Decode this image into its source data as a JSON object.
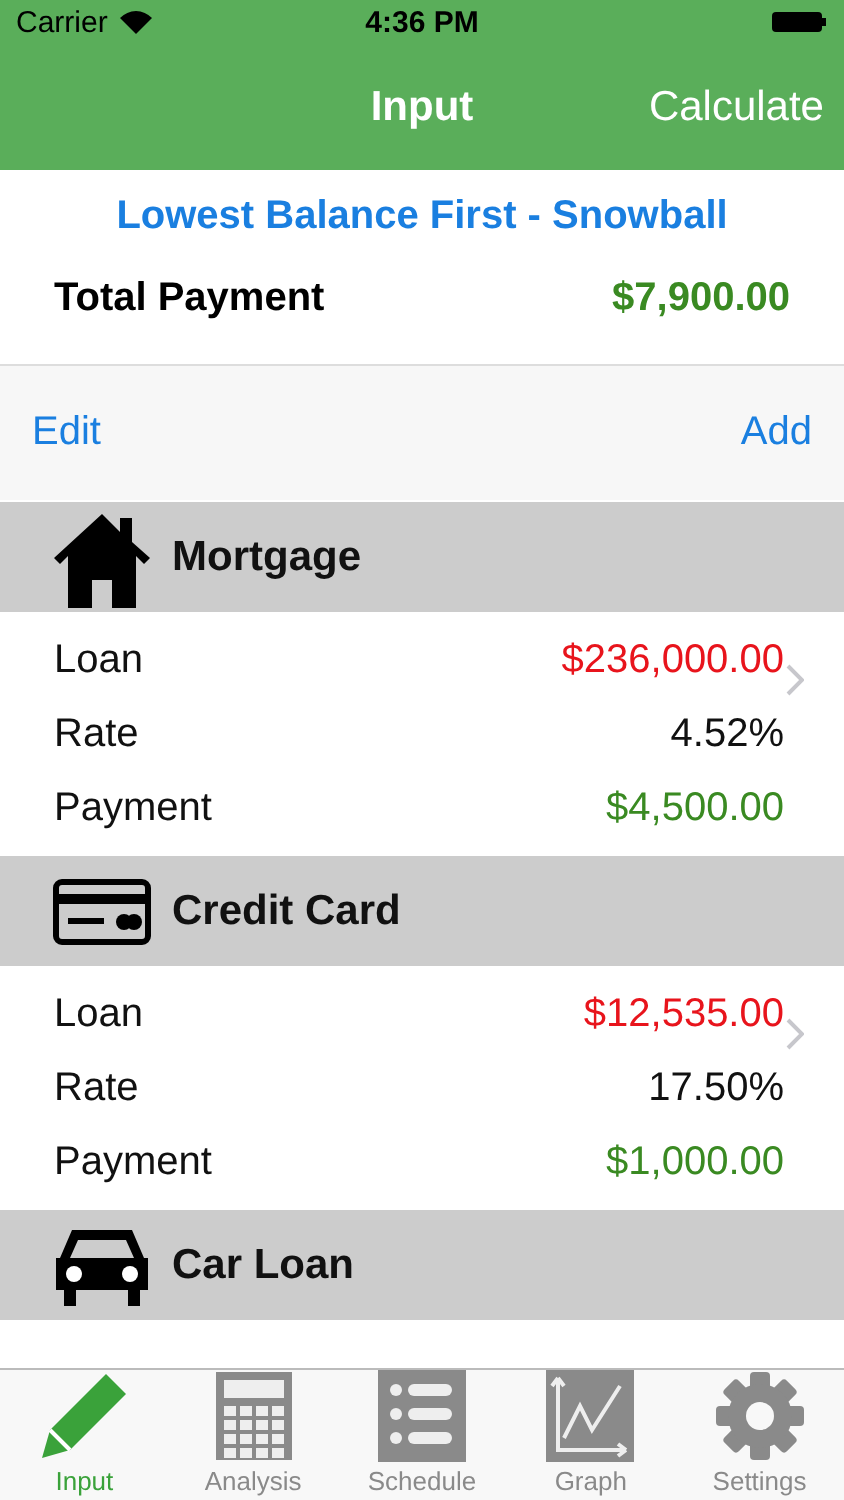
{
  "status_bar": {
    "carrier": "Carrier",
    "time": "4:36 PM"
  },
  "nav": {
    "title": "Input",
    "action": "Calculate"
  },
  "summary": {
    "strategy": "Lowest Balance First - Snowball",
    "total_label": "Total Payment",
    "total_value": "$7,900.00"
  },
  "toolbar": {
    "edit": "Edit",
    "add": "Add"
  },
  "debts": [
    {
      "name": "Mortgage",
      "kind": "house",
      "rows": [
        {
          "label": "Loan",
          "value": "$236,000.00",
          "kind": "loan"
        },
        {
          "label": "Rate",
          "value": "4.52%",
          "kind": "rate"
        },
        {
          "label": "Payment",
          "value": "$4,500.00",
          "kind": "payment"
        }
      ]
    },
    {
      "name": "Credit Card",
      "kind": "card",
      "rows": [
        {
          "label": "Loan",
          "value": "$12,535.00",
          "kind": "loan"
        },
        {
          "label": "Rate",
          "value": "17.50%",
          "kind": "rate"
        },
        {
          "label": "Payment",
          "value": "$1,000.00",
          "kind": "payment"
        }
      ]
    },
    {
      "name": "Car Loan",
      "kind": "car"
    }
  ],
  "tabs": [
    {
      "label": "Input",
      "kind": "pencil",
      "selected": true
    },
    {
      "label": "Analysis",
      "kind": "calculator",
      "selected": false
    },
    {
      "label": "Schedule",
      "kind": "list",
      "selected": false
    },
    {
      "label": "Graph",
      "kind": "graph",
      "selected": false
    },
    {
      "label": "Settings",
      "kind": "gear",
      "selected": false
    }
  ]
}
